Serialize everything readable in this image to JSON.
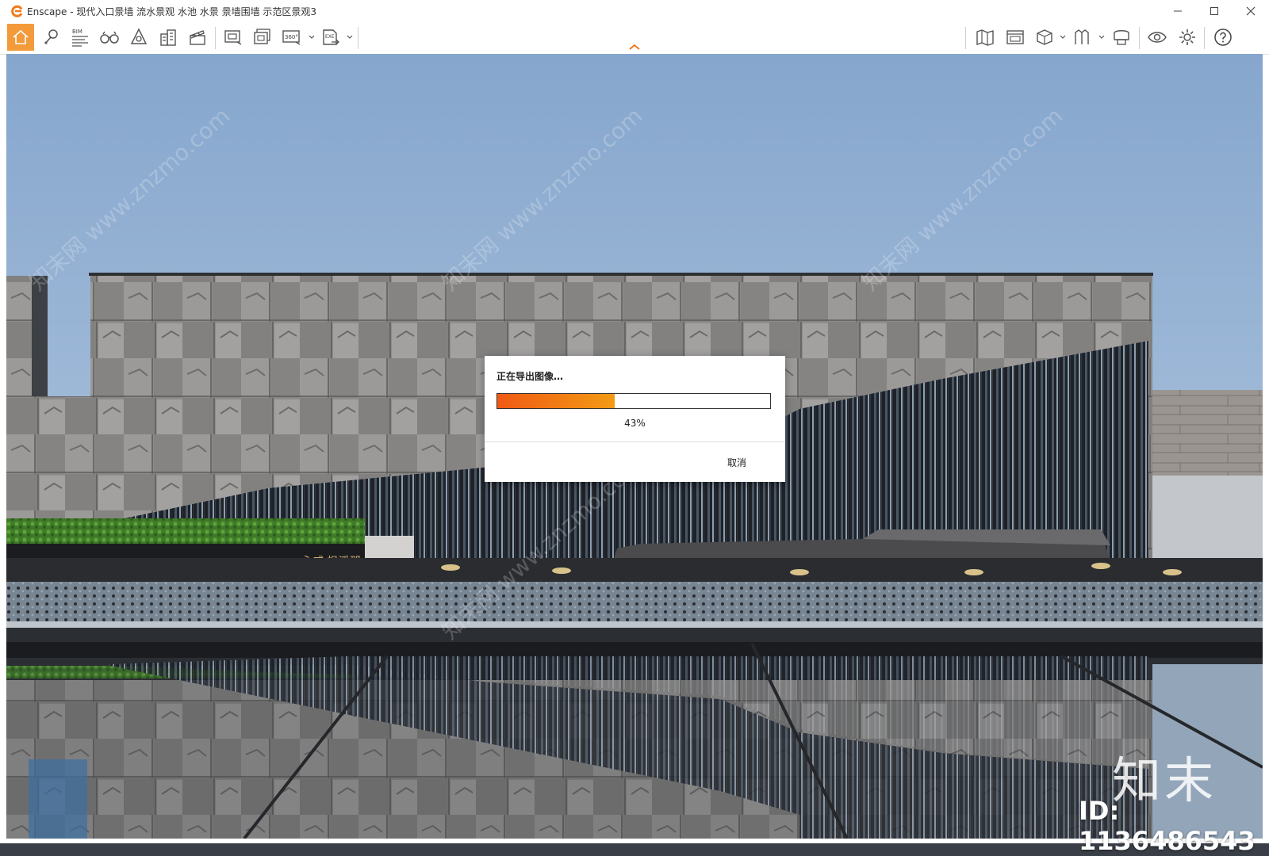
{
  "window": {
    "app_name": "Enscape",
    "title": "Enscape - 现代入口景墙 流水景观 水池 水景 景墙围墙 示范区景观3"
  },
  "toolbar": {
    "left_icons": [
      "home-icon",
      "location-pin-icon",
      "bim-icon",
      "binoculars-icon",
      "safe-frame-icon",
      "building-icon",
      "clapperboard-icon",
      "screenshot-icon",
      "batch-render-icon",
      "panorama-360-icon",
      "export-icon"
    ],
    "bim_label": "BIM",
    "panorama_label": "360°",
    "export_label": "EXE",
    "right_icons": [
      "map-icon",
      "view-manager-icon",
      "cube-icon",
      "asset-library-icon",
      "vr-headset-icon",
      "eye-icon",
      "settings-icon",
      "help-icon"
    ]
  },
  "export_dialog": {
    "title": "正在导出图像…",
    "progress": 0.43,
    "progress_text": "43%",
    "cancel_label": "取消"
  },
  "viewport": {
    "sign_text": "永威·枫溪郡",
    "watermark_text": "知末网 www.znzmo.com"
  },
  "overlay": {
    "brand": "知末",
    "id_text": "ID: 1136486543"
  },
  "colors": {
    "accent": "#f39a3a",
    "progress_start": "#f05a14",
    "progress_end": "#f39b14",
    "sky_top": "#8aaad0",
    "sky_bottom": "#b7cde3"
  }
}
